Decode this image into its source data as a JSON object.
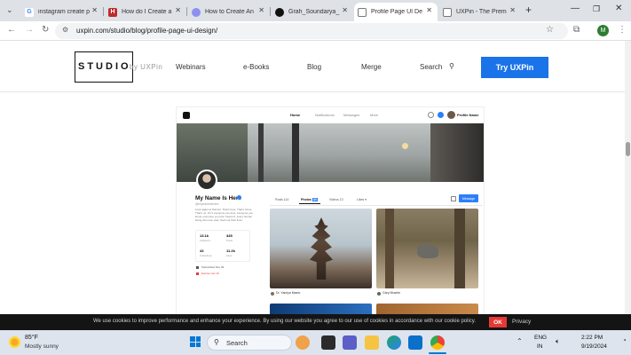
{
  "browser": {
    "tabs": [
      {
        "title": "instagram create p",
        "favicon_color": "#ffffff",
        "favicon_glyph": "G"
      },
      {
        "title": "How do I Create a",
        "favicon_color": "#c0292b",
        "favicon_glyph": "H"
      },
      {
        "title": "How to Create An",
        "favicon_color": "#6b6ee8",
        "favicon_glyph": "◎"
      },
      {
        "title": "Grah_Soundarya_",
        "favicon_color": "#111111",
        "favicon_glyph": "●"
      },
      {
        "title": "Profile Page UI De",
        "favicon_color": "#ffffff",
        "favicon_glyph": "□"
      },
      {
        "title": "UXPin - The Prem",
        "favicon_color": "#ffffff",
        "favicon_glyph": "□"
      }
    ],
    "url": "uxpin.com/studio/blog/profile-page-ui-design/",
    "profile_initial": "M"
  },
  "site": {
    "logo": "STUDIO",
    "logo_by": "by UXPin",
    "menu": [
      "Webinars",
      "e-Books",
      "Blog",
      "Merge",
      "Search"
    ],
    "cta": "Try UXPin"
  },
  "mockup": {
    "nav": [
      "Home",
      "Notifications",
      "Messages",
      "More"
    ],
    "user_short": "Profile Name",
    "name": "My Name Is Here",
    "handle": "@mynameishere",
    "bio": "Look again at that dot. That's here. That's home. That's us. On it everyone you love, everyone you know, everyone you ever heard of, every human being who ever was, lived out their lives.",
    "stats": [
      {
        "value": "13.1k",
        "label": "Followers"
      },
      {
        "value": "345",
        "label": "Posts"
      },
      {
        "value": "43",
        "label": "Collections"
      },
      {
        "value": "11.2k",
        "label": "Likes"
      }
    ],
    "badges": [
      "Subscribed Nov 09",
      "Expires Jan 10"
    ],
    "tabs": [
      {
        "label": "Posts",
        "count": "114"
      },
      {
        "label": "Photos",
        "count": "34"
      },
      {
        "label": "Videos",
        "count": "13"
      },
      {
        "label": "Likes",
        "count": "▾"
      }
    ],
    "message_btn": "Message",
    "photo_authors": [
      "Dr. Yamiya Maeio",
      "Gary Mustrie"
    ]
  },
  "cookie": {
    "text": "We use cookies to improve performance and enhance your experience. By using our website you agree to our use of cookies in accordance with our cookie policy.",
    "ok": "OK",
    "privacy": "Privacy"
  },
  "taskbar": {
    "temperature": "85°F",
    "weather": "Mostly sunny",
    "search": "Search",
    "lang": "ENG",
    "region": "IN",
    "time": "2:22 PM",
    "date": "9/19/2024"
  }
}
